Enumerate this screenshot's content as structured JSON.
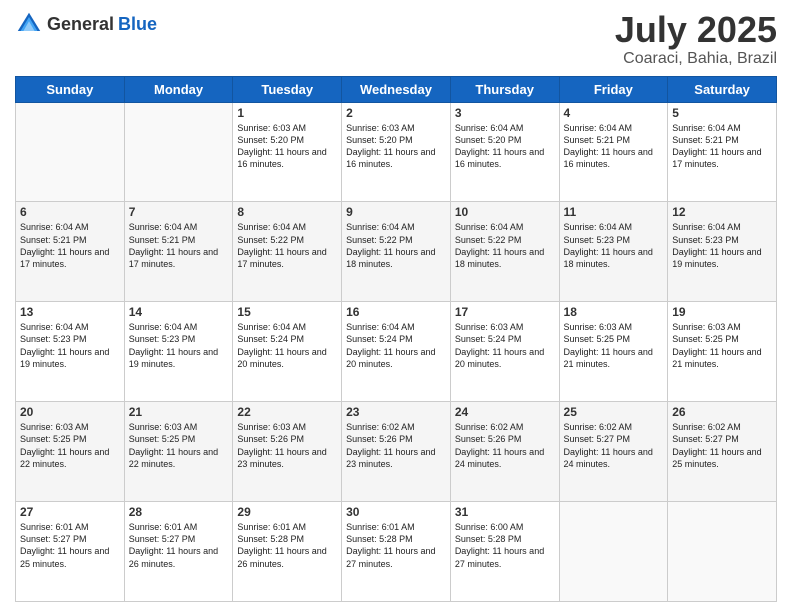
{
  "header": {
    "logo_general": "General",
    "logo_blue": "Blue",
    "title": "July 2025",
    "location": "Coaraci, Bahia, Brazil"
  },
  "days_of_week": [
    "Sunday",
    "Monday",
    "Tuesday",
    "Wednesday",
    "Thursday",
    "Friday",
    "Saturday"
  ],
  "weeks": [
    [
      {
        "day": "",
        "sunrise": "",
        "sunset": "",
        "daylight": ""
      },
      {
        "day": "",
        "sunrise": "",
        "sunset": "",
        "daylight": ""
      },
      {
        "day": "1",
        "sunrise": "Sunrise: 6:03 AM",
        "sunset": "Sunset: 5:20 PM",
        "daylight": "Daylight: 11 hours and 16 minutes."
      },
      {
        "day": "2",
        "sunrise": "Sunrise: 6:03 AM",
        "sunset": "Sunset: 5:20 PM",
        "daylight": "Daylight: 11 hours and 16 minutes."
      },
      {
        "day": "3",
        "sunrise": "Sunrise: 6:04 AM",
        "sunset": "Sunset: 5:20 PM",
        "daylight": "Daylight: 11 hours and 16 minutes."
      },
      {
        "day": "4",
        "sunrise": "Sunrise: 6:04 AM",
        "sunset": "Sunset: 5:21 PM",
        "daylight": "Daylight: 11 hours and 16 minutes."
      },
      {
        "day": "5",
        "sunrise": "Sunrise: 6:04 AM",
        "sunset": "Sunset: 5:21 PM",
        "daylight": "Daylight: 11 hours and 17 minutes."
      }
    ],
    [
      {
        "day": "6",
        "sunrise": "Sunrise: 6:04 AM",
        "sunset": "Sunset: 5:21 PM",
        "daylight": "Daylight: 11 hours and 17 minutes."
      },
      {
        "day": "7",
        "sunrise": "Sunrise: 6:04 AM",
        "sunset": "Sunset: 5:21 PM",
        "daylight": "Daylight: 11 hours and 17 minutes."
      },
      {
        "day": "8",
        "sunrise": "Sunrise: 6:04 AM",
        "sunset": "Sunset: 5:22 PM",
        "daylight": "Daylight: 11 hours and 17 minutes."
      },
      {
        "day": "9",
        "sunrise": "Sunrise: 6:04 AM",
        "sunset": "Sunset: 5:22 PM",
        "daylight": "Daylight: 11 hours and 18 minutes."
      },
      {
        "day": "10",
        "sunrise": "Sunrise: 6:04 AM",
        "sunset": "Sunset: 5:22 PM",
        "daylight": "Daylight: 11 hours and 18 minutes."
      },
      {
        "day": "11",
        "sunrise": "Sunrise: 6:04 AM",
        "sunset": "Sunset: 5:23 PM",
        "daylight": "Daylight: 11 hours and 18 minutes."
      },
      {
        "day": "12",
        "sunrise": "Sunrise: 6:04 AM",
        "sunset": "Sunset: 5:23 PM",
        "daylight": "Daylight: 11 hours and 19 minutes."
      }
    ],
    [
      {
        "day": "13",
        "sunrise": "Sunrise: 6:04 AM",
        "sunset": "Sunset: 5:23 PM",
        "daylight": "Daylight: 11 hours and 19 minutes."
      },
      {
        "day": "14",
        "sunrise": "Sunrise: 6:04 AM",
        "sunset": "Sunset: 5:23 PM",
        "daylight": "Daylight: 11 hours and 19 minutes."
      },
      {
        "day": "15",
        "sunrise": "Sunrise: 6:04 AM",
        "sunset": "Sunset: 5:24 PM",
        "daylight": "Daylight: 11 hours and 20 minutes."
      },
      {
        "day": "16",
        "sunrise": "Sunrise: 6:04 AM",
        "sunset": "Sunset: 5:24 PM",
        "daylight": "Daylight: 11 hours and 20 minutes."
      },
      {
        "day": "17",
        "sunrise": "Sunrise: 6:03 AM",
        "sunset": "Sunset: 5:24 PM",
        "daylight": "Daylight: 11 hours and 20 minutes."
      },
      {
        "day": "18",
        "sunrise": "Sunrise: 6:03 AM",
        "sunset": "Sunset: 5:25 PM",
        "daylight": "Daylight: 11 hours and 21 minutes."
      },
      {
        "day": "19",
        "sunrise": "Sunrise: 6:03 AM",
        "sunset": "Sunset: 5:25 PM",
        "daylight": "Daylight: 11 hours and 21 minutes."
      }
    ],
    [
      {
        "day": "20",
        "sunrise": "Sunrise: 6:03 AM",
        "sunset": "Sunset: 5:25 PM",
        "daylight": "Daylight: 11 hours and 22 minutes."
      },
      {
        "day": "21",
        "sunrise": "Sunrise: 6:03 AM",
        "sunset": "Sunset: 5:25 PM",
        "daylight": "Daylight: 11 hours and 22 minutes."
      },
      {
        "day": "22",
        "sunrise": "Sunrise: 6:03 AM",
        "sunset": "Sunset: 5:26 PM",
        "daylight": "Daylight: 11 hours and 23 minutes."
      },
      {
        "day": "23",
        "sunrise": "Sunrise: 6:02 AM",
        "sunset": "Sunset: 5:26 PM",
        "daylight": "Daylight: 11 hours and 23 minutes."
      },
      {
        "day": "24",
        "sunrise": "Sunrise: 6:02 AM",
        "sunset": "Sunset: 5:26 PM",
        "daylight": "Daylight: 11 hours and 24 minutes."
      },
      {
        "day": "25",
        "sunrise": "Sunrise: 6:02 AM",
        "sunset": "Sunset: 5:27 PM",
        "daylight": "Daylight: 11 hours and 24 minutes."
      },
      {
        "day": "26",
        "sunrise": "Sunrise: 6:02 AM",
        "sunset": "Sunset: 5:27 PM",
        "daylight": "Daylight: 11 hours and 25 minutes."
      }
    ],
    [
      {
        "day": "27",
        "sunrise": "Sunrise: 6:01 AM",
        "sunset": "Sunset: 5:27 PM",
        "daylight": "Daylight: 11 hours and 25 minutes."
      },
      {
        "day": "28",
        "sunrise": "Sunrise: 6:01 AM",
        "sunset": "Sunset: 5:27 PM",
        "daylight": "Daylight: 11 hours and 26 minutes."
      },
      {
        "day": "29",
        "sunrise": "Sunrise: 6:01 AM",
        "sunset": "Sunset: 5:28 PM",
        "daylight": "Daylight: 11 hours and 26 minutes."
      },
      {
        "day": "30",
        "sunrise": "Sunrise: 6:01 AM",
        "sunset": "Sunset: 5:28 PM",
        "daylight": "Daylight: 11 hours and 27 minutes."
      },
      {
        "day": "31",
        "sunrise": "Sunrise: 6:00 AM",
        "sunset": "Sunset: 5:28 PM",
        "daylight": "Daylight: 11 hours and 27 minutes."
      },
      {
        "day": "",
        "sunrise": "",
        "sunset": "",
        "daylight": ""
      },
      {
        "day": "",
        "sunrise": "",
        "sunset": "",
        "daylight": ""
      }
    ]
  ]
}
